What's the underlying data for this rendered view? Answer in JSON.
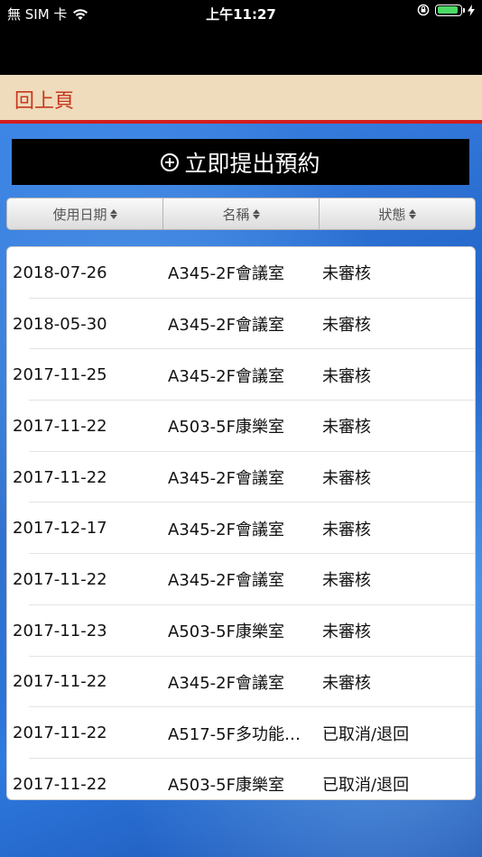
{
  "status_bar": {
    "carrier": "無 SIM 卡",
    "time": "上午11:27"
  },
  "navbar": {
    "back_label": "回上頁"
  },
  "actions": {
    "reserve_label": "立即提出預約"
  },
  "table": {
    "headers": [
      "使用日期",
      "名稱",
      "狀態"
    ],
    "rows": [
      {
        "date": "2018-07-26",
        "name": "A345-2F會議室",
        "status": "未審核"
      },
      {
        "date": "2018-05-30",
        "name": "A345-2F會議室",
        "status": "未審核"
      },
      {
        "date": "2017-11-25",
        "name": "A345-2F會議室",
        "status": "未審核"
      },
      {
        "date": "2017-11-22",
        "name": "A503-5F康樂室",
        "status": "未審核"
      },
      {
        "date": "2017-11-22",
        "name": "A345-2F會議室",
        "status": "未審核"
      },
      {
        "date": "2017-12-17",
        "name": "A345-2F會議室",
        "status": "未審核"
      },
      {
        "date": "2017-11-22",
        "name": "A345-2F會議室",
        "status": "未審核"
      },
      {
        "date": "2017-11-23",
        "name": "A503-5F康樂室",
        "status": "未審核"
      },
      {
        "date": "2017-11-22",
        "name": "A345-2F會議室",
        "status": "未審核"
      },
      {
        "date": "2017-11-22",
        "name": "A517-5F多功能…",
        "status": "已取消/退回"
      },
      {
        "date": "2017-11-22",
        "name": "A503-5F康樂室",
        "status": "已取消/退回"
      }
    ]
  },
  "colors": {
    "navbar_bg": "#eedcbc",
    "navbar_accent": "#d21e1e",
    "back_text": "#c8361e",
    "battery": "#4cd964"
  }
}
